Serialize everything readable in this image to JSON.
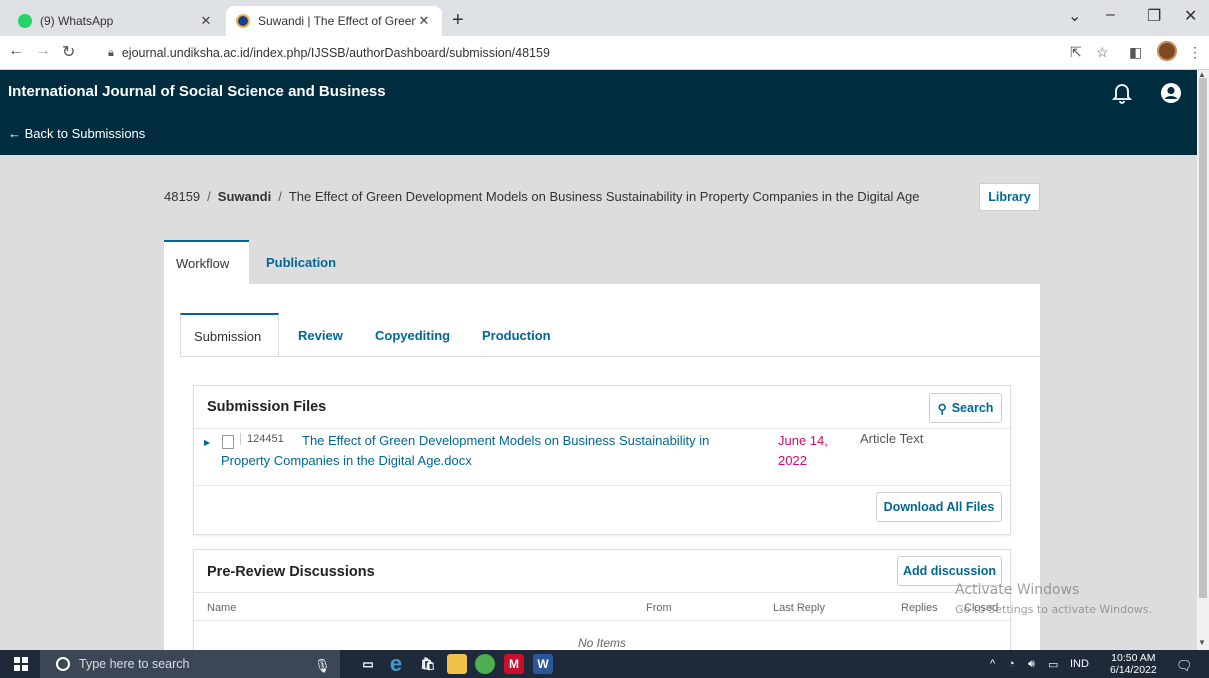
{
  "browser": {
    "tabs": [
      {
        "title": "(9) WhatsApp",
        "active": false
      },
      {
        "title": "Suwandi | The Effect of Green De",
        "active": true
      }
    ],
    "url": "ejournal.undiksha.ac.id/index.php/IJSSB/authorDashboard/submission/48159"
  },
  "header": {
    "journal_title": "International Journal of Social Science and Business",
    "back_label": "← Back to Submissions"
  },
  "breadcrumb": {
    "id": "48159",
    "author": "Suwandi",
    "title": "The Effect of Green Development Models on Business Sustainability in Property Companies in the Digital Age",
    "library_label": "Library"
  },
  "main_tabs": [
    "Workflow",
    "Publication"
  ],
  "stage_tabs": [
    "Submission",
    "Review",
    "Copyediting",
    "Production"
  ],
  "submission_files": {
    "title": "Submission Files",
    "search_label": "Search",
    "file": {
      "id": "124451",
      "name_line1": "The Effect of Green Development Models on Business Sustainability in",
      "name_line2": "Property Companies in the Digital Age.docx",
      "date_line1": "June 14,",
      "date_line2": "2022",
      "type": "Article Text"
    },
    "download_label": "Download All Files"
  },
  "discussions": {
    "title": "Pre-Review Discussions",
    "add_label": "Add discussion",
    "columns": [
      "Name",
      "From",
      "Last Reply",
      "Replies",
      "Closed"
    ],
    "empty": "No Items"
  },
  "watermark": {
    "line1": "Activate Windows",
    "line2": "Go to Settings to activate Windows."
  },
  "taskbar": {
    "search_placeholder": "Type here to search",
    "lang": "IND",
    "time": "10:50 AM",
    "date": "6/14/2022"
  },
  "colors": {
    "header_bg": "#002c40",
    "link": "#006798",
    "date": "#d00a6c"
  }
}
